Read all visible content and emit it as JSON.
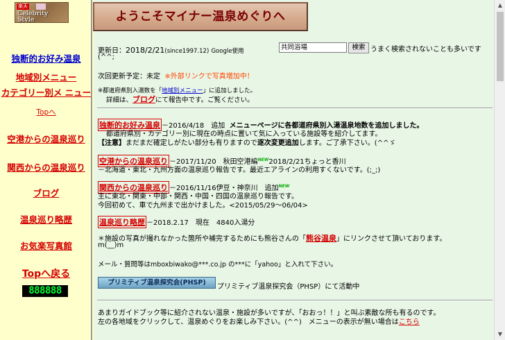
{
  "sidebar": {
    "banner": {
      "logo_rakuten": "楽天",
      "title_line1": "Celebrity",
      "title_line2": "Style"
    },
    "nav": [
      {
        "label": "独断的お好み温泉"
      },
      {
        "label": "地域別メニュー"
      },
      {
        "label": "カテゴリー別メ ニュー"
      },
      {
        "label": "Topへ"
      },
      {
        "label": "空港からの温泉巡り"
      },
      {
        "label": "関西からの温泉巡り"
      },
      {
        "label": "ブログ"
      },
      {
        "label": "温泉巡り略歴"
      },
      {
        "label": "お気楽写真館"
      },
      {
        "label": "Topへ戻る"
      }
    ],
    "counter": "888888"
  },
  "header": {
    "title": "ようこそマイナー温泉めぐりへ"
  },
  "update": {
    "label": "更新日：",
    "date": "2018/2/21",
    "since": "(since1997.12)",
    "google_label": "Google使用",
    "search_value": "共同浴場",
    "search_button": "検索",
    "search_note": "うまく検索されないことも多いです",
    "emoticon": "(^^;",
    "next_label": "次回更新予定：未定",
    "next_note": "※外部リンクで写真増加中！",
    "pref_note": "※都道府県別入湯数を「地域別メニュー」に追加しました。",
    "pref_link": "地域別メニュー",
    "blog_note_pre": "詳細は、",
    "blog_link": "ブログ",
    "blog_note_post": "にて報告中です。ご覧ください。"
  },
  "sections": {
    "s1": {
      "link": "独断的お好み温泉",
      "date": "－2016/4/18　追加",
      "bold": "メニューページに各都道府県別入湯温泉地数を追加しました。",
      "line2": "都道府県別・カテゴリー別に現在の時点に置いて気に入っている施設等を紹介してます。",
      "caution_label": "【注意】",
      "caution": "まだまだ確定しがたい部分も有りますので",
      "caution_bold": "逐次変更追加",
      "caution_end": "します。ご了承下さい。(^^ゞ"
    },
    "s2": {
      "link": "空港からの温泉巡り",
      "date": "－2017/11/20　秋田空港編",
      "new": "NEW",
      "date2": "2018/2/21ちょっと香川",
      "line2": "－北海道・東北・九州方面の温泉巡り報告です。最近エアラインの利用すくないです。(;_;)"
    },
    "s3": {
      "link": "関西からの温泉巡り",
      "date": "－2016/11/16伊豆・神奈川　追加",
      "new": "NEW",
      "line2": "主に東北・関東・中部・関西・中国・四国の温泉巡り報告です。",
      "line3": "今回初めて、車で九州まで出かけました。<2015/05/29～06/04>"
    },
    "s4": {
      "link": "温泉巡り略歴",
      "date": "－2018.2.17　現在　4840入湯分"
    },
    "kumagaya": {
      "pre": "＊施設の写真が撮れなかった箇所や補完するためにも熊谷さんの",
      "link": "熊谷温泉",
      "post": "にリンクさせて頂いております。",
      "line2": "m(__)m"
    },
    "mail": "メール・質問等はmboxbiwako@***.co.jp の***に「yahoo」と入れて下さい。",
    "phsp": {
      "button": "プリミティブ温泉探究会(PHSP)",
      "text": "プリミティブ温泉探究会（PHSP）にて活動中"
    },
    "footer": {
      "line1": "あまりガイドブック等に紹介されない温泉・施設が多いですが、「おおっ！！」と叫ぶ素敵な所も有るのです。",
      "line2_pre": "左の各地域をクリックして、温泉めぐりをお楽しみ下さい。(^^)　メニューの表示が無い場合は",
      "line2_link": "こちら"
    }
  },
  "colors": {
    "accent_red": "#d40000",
    "link_blue": "#0000cc",
    "counter_green": "#00ff33",
    "bg_right": "#e8f6e6",
    "bg_left": "#ffffcc"
  }
}
